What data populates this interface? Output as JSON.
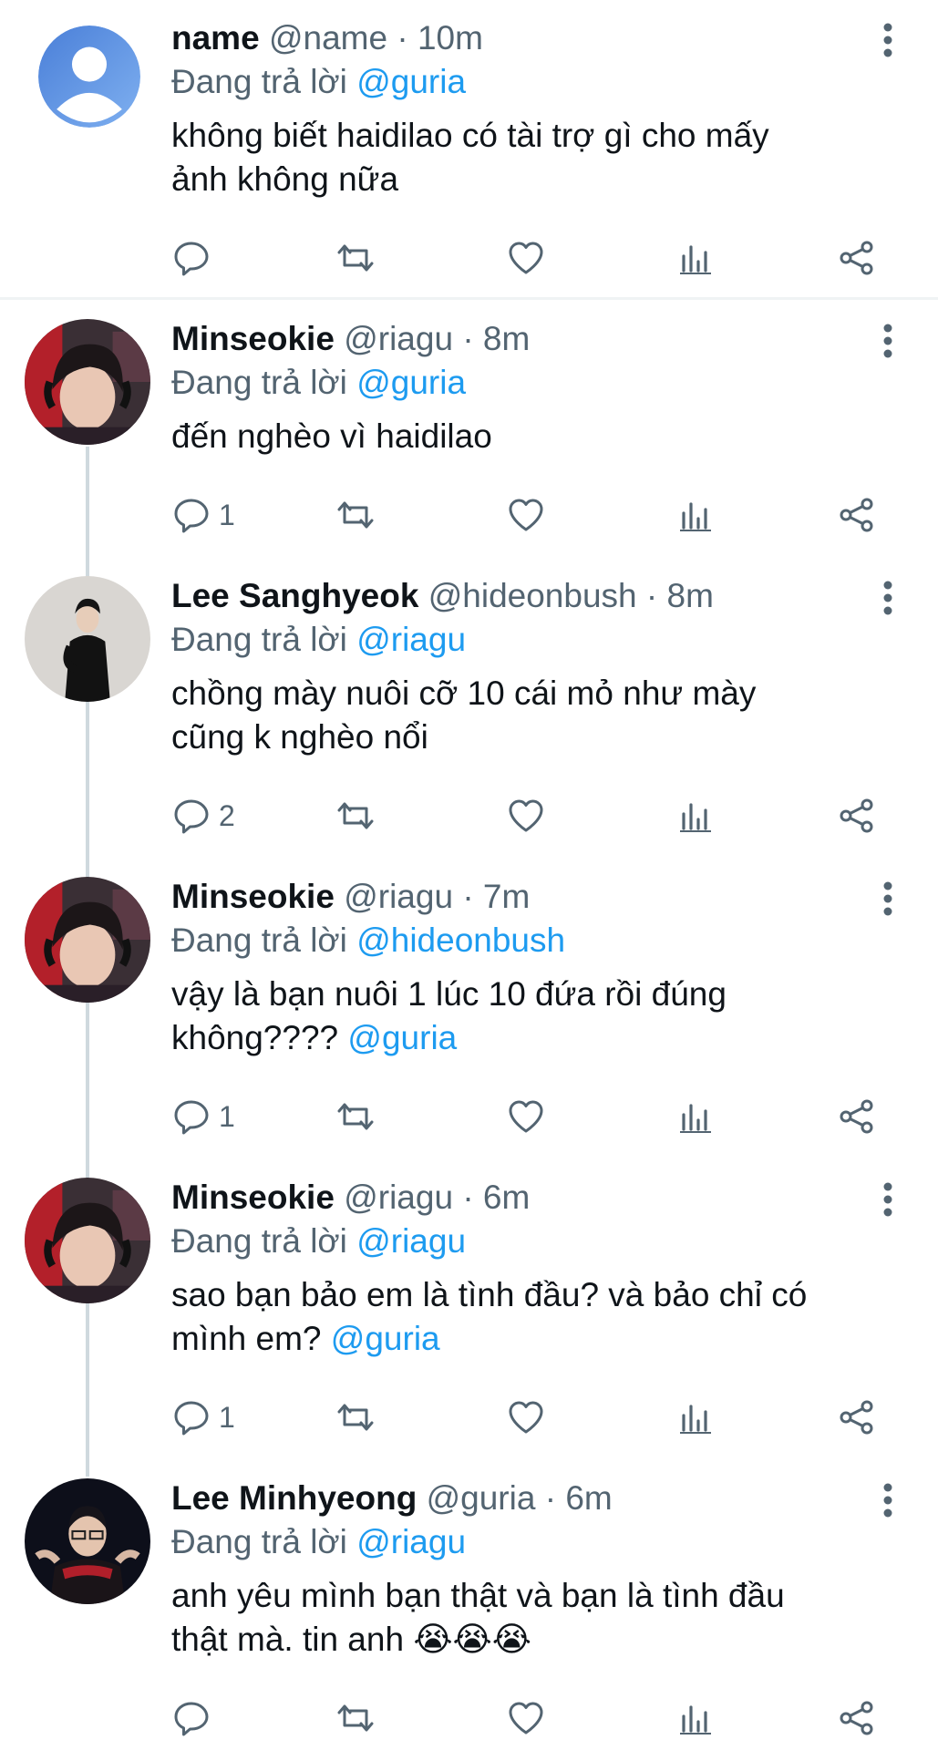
{
  "reply_prefix": "Đang trả lời",
  "tweets": [
    {
      "display_name": "name",
      "handle": "@name",
      "separator": "·",
      "time": "10m",
      "replying_to": "@guria",
      "text": "không biết haidilao có tài trợ gì cho mấy\nảnh không nữa",
      "mention_suffix": "",
      "reply_count": "",
      "avatar": "default-avatar"
    },
    {
      "display_name": "Minseokie",
      "handle": "@riagu",
      "separator": "·",
      "time": "8m",
      "replying_to": "@guria",
      "text": "đến nghèo vì haidilao",
      "mention_suffix": "",
      "reply_count": "1",
      "avatar": "minseokie-avatar"
    },
    {
      "display_name": "Lee Sanghyeok",
      "handle": "@hideonbush",
      "separator": "·",
      "time": "8m",
      "replying_to": "@riagu",
      "text": "chồng mày nuôi cỡ 10 cái mỏ như mày\ncũng k nghèo nổi",
      "mention_suffix": "",
      "reply_count": "2",
      "avatar": "sanghyeok-avatar"
    },
    {
      "display_name": "Minseokie",
      "handle": "@riagu",
      "separator": "·",
      "time": "7m",
      "replying_to": "@hideonbush",
      "text": "vậy là bạn nuôi 1 lúc 10 đứa rồi đúng\nkhông????",
      "mention_suffix": "@guria",
      "reply_count": "1",
      "avatar": "minseokie-avatar"
    },
    {
      "display_name": "Minseokie",
      "handle": "@riagu",
      "separator": "·",
      "time": "6m",
      "replying_to": "@riagu",
      "text": "sao bạn bảo em là tình đầu? và bảo chỉ có\nmình em?",
      "mention_suffix": "@guria",
      "reply_count": "1",
      "avatar": "minseokie-avatar"
    },
    {
      "display_name": "Lee Minhyeong",
      "handle": "@guria",
      "separator": "·",
      "time": "6m",
      "replying_to": "@riagu",
      "text": "anh yêu mình bạn thật và bạn là tình đầu\nthật mà. tin anh 😭😭😭",
      "mention_suffix": "",
      "reply_count": "",
      "avatar": "minhyeong-avatar"
    }
  ],
  "colors": {
    "mention": "#1d9bf0",
    "secondary_text": "#536471",
    "thread_line": "#cfd9de"
  }
}
